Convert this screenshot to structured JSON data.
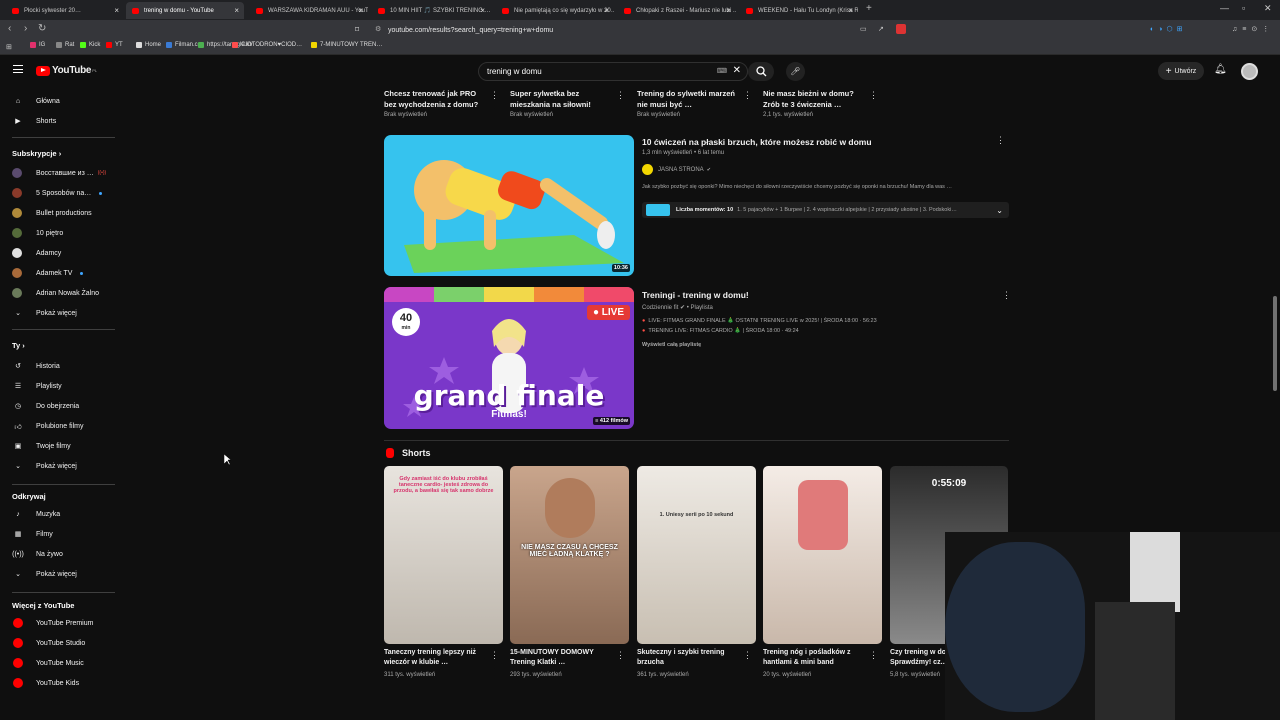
{
  "browser": {
    "tabs": [
      {
        "label": "Płocki sylwester 20…",
        "active": false
      },
      {
        "label": "trening w domu - YouTube",
        "active": true
      },
      {
        "label": "WARSZAWA KIDRAMAN AUU - YouT…",
        "active": false
      },
      {
        "label": "10 MIN HIIT 🎵 SZYBKI TRENING …",
        "active": false
      },
      {
        "label": "Nie pamiętają co się wydarzyło w 20…",
        "active": false
      },
      {
        "label": "Chłopaki z Raszei - Mariusz nie lubi …",
        "active": false
      },
      {
        "label": "WEEKEND - Hału Tu Londyn (Kriss R…",
        "active": false
      }
    ],
    "url": "youtube.com/results?search_query=trening+w+domu",
    "bookmarks": [
      "IG",
      "Rat",
      "Kick",
      "YT",
      "Home",
      "Filman.cc",
      "https://tanggle.io/",
      "CIOTODRON♥CIOD…",
      "7-MINUTOWY TREN…"
    ]
  },
  "header": {
    "logo": "YouTube",
    "region": "PL",
    "search_value": "trening w domu",
    "create_label": "Utwórz"
  },
  "sidebar": {
    "main": [
      {
        "label": "Główna",
        "icon": "home-icon"
      },
      {
        "label": "Shorts",
        "icon": "shorts-icon"
      }
    ],
    "subs_title": "Subskrypcje",
    "subs": [
      {
        "label": "Восставшие из …",
        "color": "#5a4b6e",
        "badge": "live"
      },
      {
        "label": "5 Sposobów na…",
        "color": "#8a3a2a",
        "badge": "dot"
      },
      {
        "label": "Bullet productions",
        "color": "#b08a3a",
        "badge": ""
      },
      {
        "label": "10 piętro",
        "color": "#556b3a",
        "badge": ""
      },
      {
        "label": "Adamcy",
        "color": "#e0e0e0",
        "badge": ""
      },
      {
        "label": "Adamek TV",
        "color": "#a86a3a",
        "badge": "dot"
      },
      {
        "label": "Adrian Nowak Żalno",
        "color": "#6a7a5a",
        "badge": ""
      }
    ],
    "subs_more": "Pokaż więcej",
    "you_title": "Ty",
    "you": [
      {
        "label": "Historia",
        "icon": "history-icon"
      },
      {
        "label": "Playlisty",
        "icon": "playlist-icon"
      },
      {
        "label": "Do obejrzenia",
        "icon": "clock-icon"
      },
      {
        "label": "Polubione filmy",
        "icon": "like-icon"
      },
      {
        "label": "Twoje filmy",
        "icon": "video-icon"
      },
      {
        "label": "Pokaż więcej",
        "icon": "chevron-down-icon"
      }
    ],
    "explore_title": "Odkrywaj",
    "explore": [
      {
        "label": "Muzyka",
        "icon": "music-icon"
      },
      {
        "label": "Filmy",
        "icon": "film-icon"
      },
      {
        "label": "Na żywo",
        "icon": "live-icon"
      },
      {
        "label": "Pokaż więcej",
        "icon": "chevron-down-icon"
      }
    ],
    "more_title": "Więcej z YouTube",
    "more": [
      {
        "label": "YouTube Premium"
      },
      {
        "label": "YouTube Studio"
      },
      {
        "label": "YouTube Music"
      },
      {
        "label": "YouTube Kids"
      }
    ]
  },
  "top_row": [
    {
      "title": "Chcesz trenować jak PRO bez wychodzenia z domu?",
      "meta": "Brak wyświetleń"
    },
    {
      "title": "Super sylwetka bez mieszkania na siłowni!",
      "meta": "Brak wyświetleń"
    },
    {
      "title": "Trening do sylwetki marzeń nie musi być …",
      "meta": "Brak wyświetleń"
    },
    {
      "title": "Nie masz bieżni w domu? Zrób te 3 ćwiczenia …",
      "meta": "2,1 tys. wyświetleń"
    }
  ],
  "video1": {
    "title": "10 ćwiczeń na płaski brzuch, które możesz robić w domu",
    "meta": "1,3 mln wyświetleń • 6 lat temu",
    "channel": "JASNA STRONA",
    "desc": "Jak szybko pozbyć się oponki? Mimo niechęci do siłowni rzeczywiście chcemy pozbyć się oponki na brzuchu! Mamy dla was …",
    "moments_label": "Liczba momentów: 10",
    "moments_text": "1. 5 pajacyków + 1 Burpee | 2. 4 wspinaczki alpejskie | 2 przysiady ukośne | 3. Podskoki…",
    "duration": "10:36"
  },
  "playlist": {
    "title": "Treningi  - trening w domu!",
    "channel": "Codziennie fit",
    "type": "Playlista",
    "items": [
      "LIVE: FITMAS GRAND FINALE 🎄 OSTATNI TRENING LIVE w 2025! | ŚRODA 18:00 · 56:23",
      "TRENING LIVE: FITMAS CARDIO 🎄 | ŚRODA 18:00 · 49:24"
    ],
    "view_all": "Wyświetl całą playlistę",
    "count": "412 filmów",
    "thumb_big": "grand finale",
    "thumb_sub": "Fitmas!",
    "thumb_live": "LIVE",
    "thumb_min": "40",
    "thumb_min_unit": "min"
  },
  "shorts": {
    "title": "Shorts",
    "items": [
      {
        "title": "Taneczny trening lepszy niż wieczór w klubie …",
        "views": "311 tys. wyświetleń",
        "overlay": "Gdy zamiast iść do klubu zrobiłaś taneczne cardio- jesteś zdrowa do przodu, a bawiłaś się tak samo dobrze"
      },
      {
        "title": "15-MINUTOWY DOMOWY Trening Klatki …",
        "views": "293 tys. wyświetleń",
        "overlay": "NIE MASZ CZASU A CHCESZ MIEĆ ŁADNĄ KLATKĘ ?"
      },
      {
        "title": "Skuteczny i szybki trening brzucha",
        "views": "361 tys. wyświetleń",
        "overlay": "1. Uniesy serii po 10 sekund"
      },
      {
        "title": "Trening nóg i pośladków z hantlami & mini band",
        "views": "20 tys. wyświetleń",
        "overlay": ""
      },
      {
        "title": "Czy trening w do… Sprawdźmy! cz.…",
        "views": "5,8 tys. wyświetleń",
        "overlay": "0:55:09"
      }
    ]
  },
  "colors": {
    "bg": "#0f0f0f",
    "accent": "#ff0000",
    "link": "#3ea6ff"
  }
}
